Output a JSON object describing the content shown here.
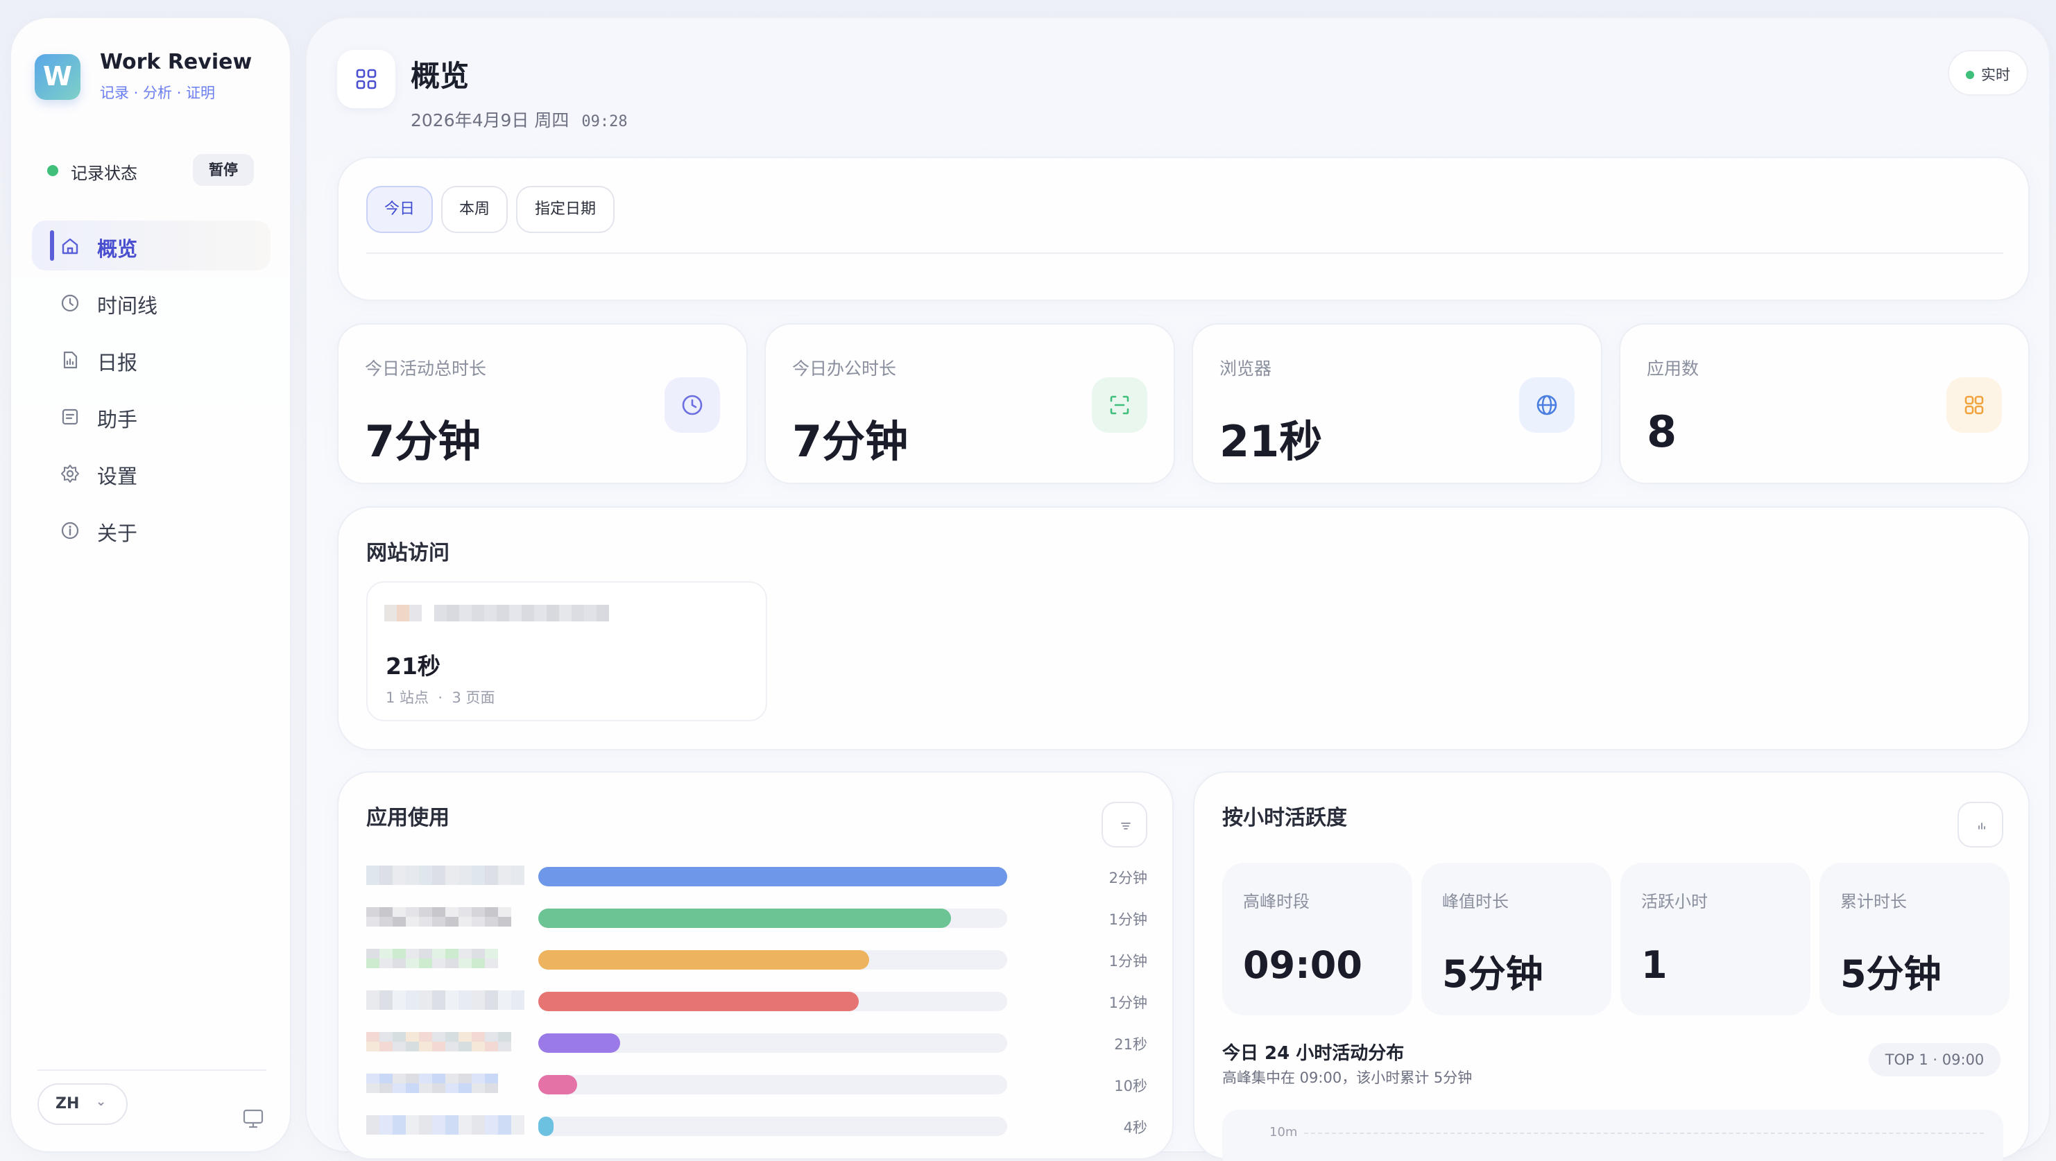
{
  "app": {
    "name": "Work Review",
    "tagline": [
      "记录",
      "分析",
      "证明"
    ],
    "recording_label": "记录状态",
    "pause_label": "暂停",
    "language": "ZH"
  },
  "nav": [
    {
      "label": "概览",
      "icon": "home-icon",
      "active": true
    },
    {
      "label": "时间线",
      "icon": "clock-icon",
      "active": false
    },
    {
      "label": "日报",
      "icon": "report-icon",
      "active": false
    },
    {
      "label": "助手",
      "icon": "assistant-icon",
      "active": false
    },
    {
      "label": "设置",
      "icon": "gear-icon",
      "active": false
    },
    {
      "label": "关于",
      "icon": "info-icon",
      "active": false
    }
  ],
  "header": {
    "title": "概览",
    "date": "2026年4月9日 周四",
    "time": "09:28",
    "live_label": "实时"
  },
  "filters": [
    {
      "label": "今日",
      "active": true
    },
    {
      "label": "本周",
      "active": false
    },
    {
      "label": "指定日期",
      "active": false
    }
  ],
  "stats": [
    {
      "label": "今日活动总时长",
      "value": "7分钟",
      "icon": "clock-icon",
      "color": "#6b6fe0"
    },
    {
      "label": "今日办公时长",
      "value": "7分钟",
      "icon": "scan-icon",
      "color": "#3fbf7a"
    },
    {
      "label": "浏览器",
      "value": "21秒",
      "icon": "globe-icon",
      "color": "#4a7ee0"
    },
    {
      "label": "应用数",
      "value": "8",
      "icon": "apps-icon",
      "color": "#f0a23c"
    }
  ],
  "website": {
    "title": "网站访问",
    "value": "21秒",
    "sites": "1 站点",
    "pages": "3 页面"
  },
  "apps": {
    "title": "应用使用",
    "rows": [
      {
        "duration": "2分钟",
        "fraction": 1.0,
        "color": "#6e97ea"
      },
      {
        "duration": "1分钟",
        "fraction": 0.88,
        "color": "#6cc494"
      },
      {
        "duration": "1分钟",
        "fraction": 0.706,
        "color": "#eeb35e"
      },
      {
        "duration": "1分钟",
        "fraction": 0.683,
        "color": "#e57472"
      },
      {
        "duration": "21秒",
        "fraction": 0.175,
        "color": "#9a7ae6"
      },
      {
        "duration": "10秒",
        "fraction": 0.083,
        "color": "#e472a6"
      },
      {
        "duration": "4秒",
        "fraction": 0.033,
        "color": "#6cc0e0"
      }
    ]
  },
  "hours": {
    "title": "按小时活跃度",
    "kpis": [
      {
        "label": "高峰时段",
        "value": "09:00"
      },
      {
        "label": "峰值时长",
        "value": "5分钟"
      },
      {
        "label": "活跃小时",
        "value": "1"
      },
      {
        "label": "累计时长",
        "value": "5分钟"
      }
    ],
    "dist_title": "今日 24 小时活动分布",
    "dist_sub": "高峰集中在 09:00，该小时累计 5分钟",
    "top_label": "TOP 1 · 09:00",
    "y_tick": "10m"
  }
}
